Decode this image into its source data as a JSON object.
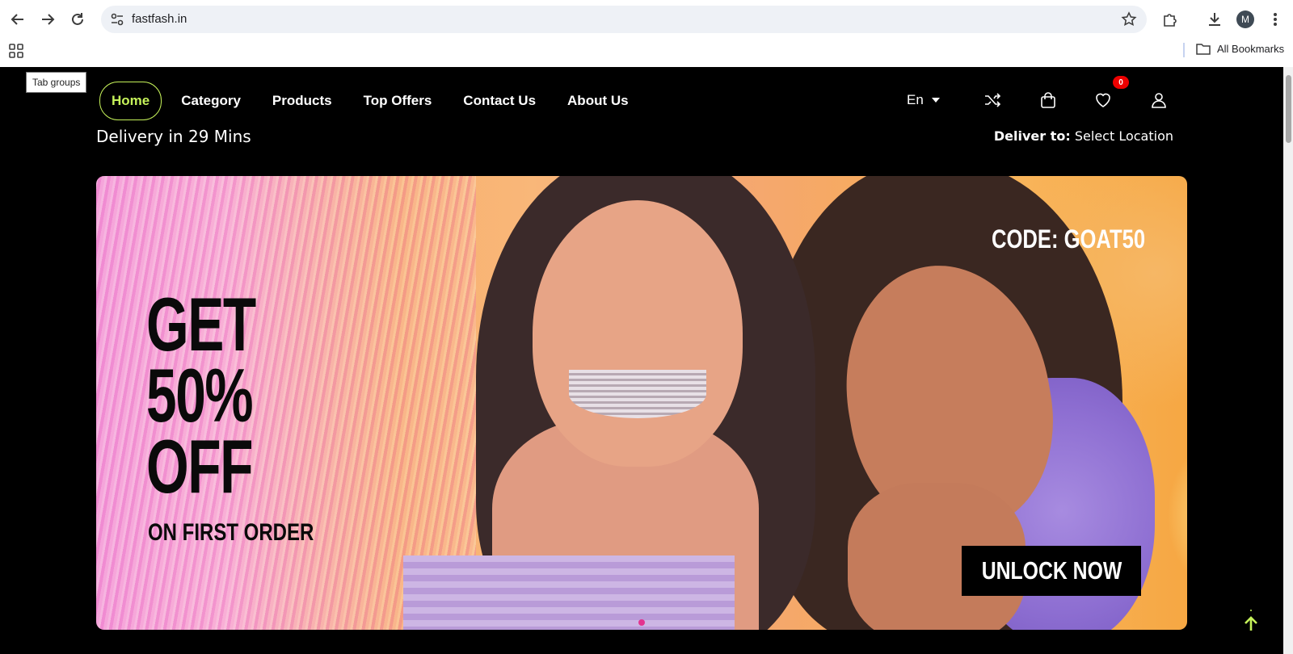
{
  "browser": {
    "url": "fastfash.in",
    "profile_initial": "M",
    "bookmarks_label": "All Bookmarks",
    "tooltip": "Tab groups"
  },
  "site": {
    "nav": [
      {
        "label": "Home",
        "active": true
      },
      {
        "label": "Category"
      },
      {
        "label": "Products"
      },
      {
        "label": "Top Offers"
      },
      {
        "label": "Contact Us"
      },
      {
        "label": "About Us"
      }
    ],
    "language": "En",
    "wishlist_count": "0",
    "delivery_text": "Delivery in 29 Mins",
    "deliver_to_label": "Deliver to:",
    "deliver_to_value": "Select Location",
    "accent_color": "#c6f25a"
  },
  "banner": {
    "headline_lines": [
      "GET",
      "50%",
      "OFF"
    ],
    "subline": "ON FIRST ORDER",
    "code": "CODE: GOAT50",
    "cta": "UNLOCK NOW"
  }
}
